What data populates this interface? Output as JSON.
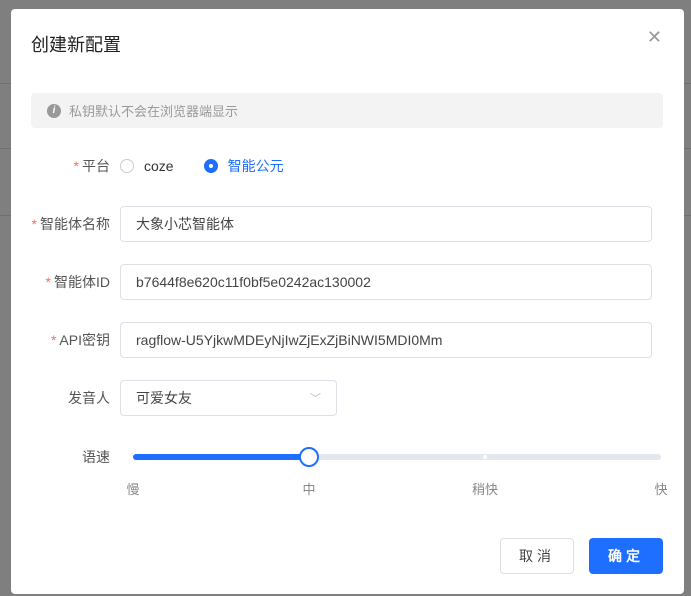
{
  "dialog": {
    "title": "创建新配置",
    "close_icon": "close-icon"
  },
  "alert": {
    "text": "私钥默认不会在浏览器端显示"
  },
  "form": {
    "platform": {
      "label": "平台",
      "options": [
        "coze",
        "智能公元"
      ],
      "selected": "智能公元"
    },
    "agent_name": {
      "label": "智能体名称",
      "value": "大象小芯智能体"
    },
    "agent_id": {
      "label": "智能体ID",
      "value": "b7644f8e620c11f0bf5e0242ac130002"
    },
    "api_key": {
      "label": "API密钥",
      "value": "ragflow-U5YjkwMDEyNjIwZjExZjBiNWI5MDI0Mm"
    },
    "voice": {
      "label": "发音人",
      "value": "可爱女友"
    },
    "speed": {
      "label": "语速",
      "marks": [
        "慢",
        "中",
        "稍快",
        "快"
      ],
      "value_index": 1,
      "max_index": 3
    }
  },
  "buttons": {
    "cancel": "取消",
    "confirm": "确定"
  },
  "colors": {
    "primary": "#1e6fff",
    "required": "#f56c6c"
  }
}
